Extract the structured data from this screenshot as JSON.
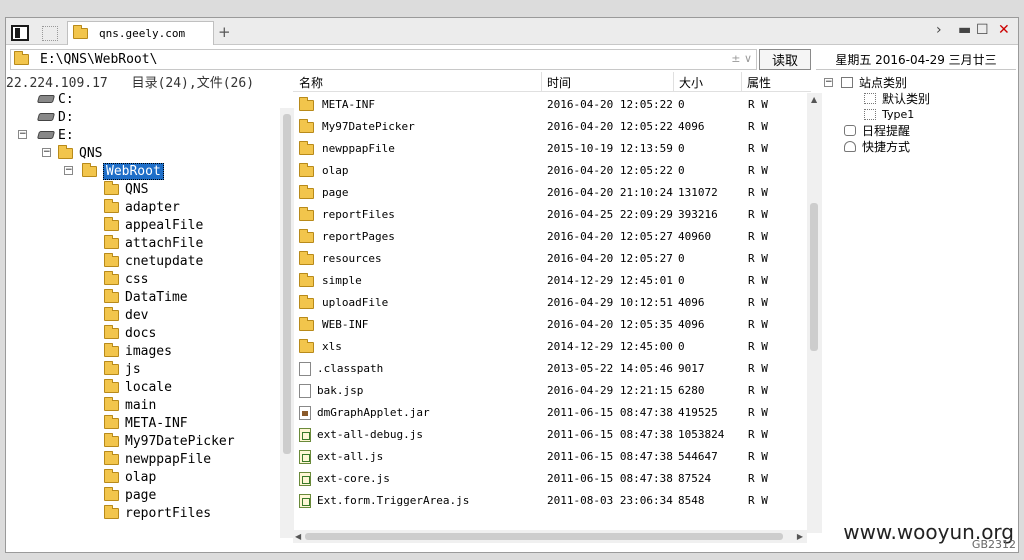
{
  "tab": {
    "title": "qns.geely.com"
  },
  "address": {
    "value": "E:\\QNS\\WebRoot\\",
    "read_label": "读取",
    "dropdown_glyph": "± ∨"
  },
  "date_header": "星期五 2016-04-29 三月廿三",
  "info": {
    "ip": "22.224.109.17",
    "counts": "目录(24),文件(26)"
  },
  "tree": {
    "drives": [
      "C:",
      "D:",
      "E:"
    ],
    "e_children": [
      "QNS"
    ],
    "qns_children": [
      "WebRoot"
    ],
    "webroot_children": [
      "QNS",
      "adapter",
      "appealFile",
      "attachFile",
      "cnetupdate",
      "css",
      "DataTime",
      "dev",
      "docs",
      "images",
      "js",
      "locale",
      "main",
      "META-INF",
      "My97DatePicker",
      "newppapFile",
      "olap",
      "page",
      "reportFiles"
    ]
  },
  "list": {
    "columns": {
      "name": "名称",
      "time": "时间",
      "size": "大小",
      "attr": "属性"
    },
    "rows": [
      {
        "type": "folder",
        "name": "META-INF",
        "time": "2016-04-20 12:05:22",
        "size": "0",
        "attr": "R W"
      },
      {
        "type": "folder",
        "name": "My97DatePicker",
        "time": "2016-04-20 12:05:22",
        "size": "4096",
        "attr": "R W"
      },
      {
        "type": "folder",
        "name": "newppapFile",
        "time": "2015-10-19 12:13:59",
        "size": "0",
        "attr": "R W"
      },
      {
        "type": "folder",
        "name": "olap",
        "time": "2016-04-20 12:05:22",
        "size": "0",
        "attr": "R W"
      },
      {
        "type": "folder",
        "name": "page",
        "time": "2016-04-20 21:10:24",
        "size": "131072",
        "attr": "R W"
      },
      {
        "type": "folder",
        "name": "reportFiles",
        "time": "2016-04-25 22:09:29",
        "size": "393216",
        "attr": "R W"
      },
      {
        "type": "folder",
        "name": "reportPages",
        "time": "2016-04-20 12:05:27",
        "size": "40960",
        "attr": "R W"
      },
      {
        "type": "folder",
        "name": "resources",
        "time": "2016-04-20 12:05:27",
        "size": "0",
        "attr": "R W"
      },
      {
        "type": "folder",
        "name": "simple",
        "time": "2014-12-29 12:45:01",
        "size": "0",
        "attr": "R W"
      },
      {
        "type": "folder",
        "name": "uploadFile",
        "time": "2016-04-29 10:12:51",
        "size": "4096",
        "attr": "R W"
      },
      {
        "type": "folder",
        "name": "WEB-INF",
        "time": "2016-04-20 12:05:35",
        "size": "4096",
        "attr": "R W"
      },
      {
        "type": "folder",
        "name": "xls",
        "time": "2014-12-29 12:45:00",
        "size": "0",
        "attr": "R W"
      },
      {
        "type": "file",
        "name": ".classpath",
        "time": "2013-05-22 14:05:46",
        "size": "9017",
        "attr": "R W"
      },
      {
        "type": "file",
        "name": "bak.jsp",
        "time": "2016-04-29 12:21:15",
        "size": "6280",
        "attr": "R W"
      },
      {
        "type": "jar",
        "name": "dmGraphApplet.jar",
        "time": "2011-06-15 08:47:38",
        "size": "419525",
        "attr": "R W"
      },
      {
        "type": "js",
        "name": "ext-all-debug.js",
        "time": "2011-06-15 08:47:38",
        "size": "1053824",
        "attr": "R W"
      },
      {
        "type": "js",
        "name": "ext-all.js",
        "time": "2011-06-15 08:47:38",
        "size": "544647",
        "attr": "R W"
      },
      {
        "type": "js",
        "name": "ext-core.js",
        "time": "2011-06-15 08:47:38",
        "size": "87524",
        "attr": "R W"
      },
      {
        "type": "js",
        "name": "Ext.form.TriggerArea.js",
        "time": "2011-08-03 23:06:34",
        "size": "8548",
        "attr": "R W"
      }
    ]
  },
  "right_panel": {
    "root": "站点类别",
    "children": [
      "默认类别",
      "Type1"
    ],
    "reminder": "日程提醒",
    "shortcut": "快捷方式"
  },
  "watermark": "www.wooyun.org",
  "status": "GB2312"
}
